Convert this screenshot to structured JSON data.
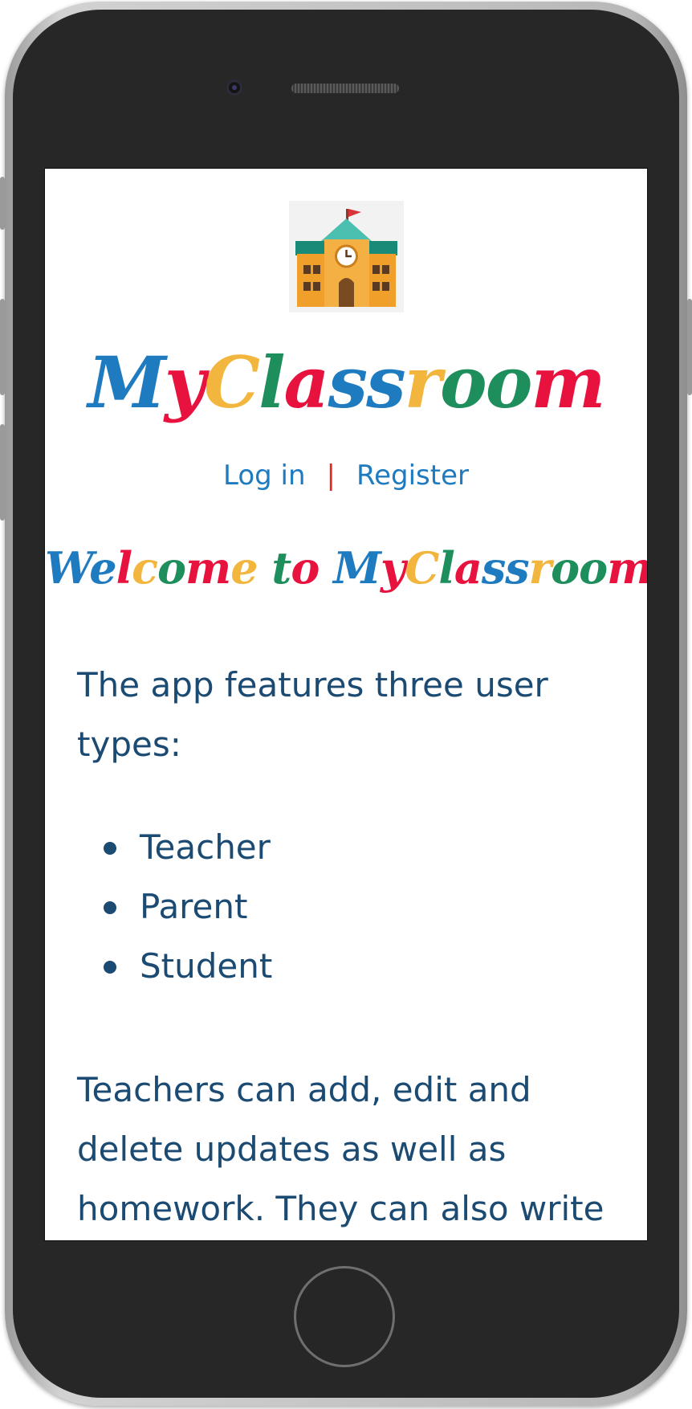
{
  "app": {
    "brand_title": "MyClassroom",
    "brand_letters": [
      {
        "ch": "M",
        "color": "#1f7bbf"
      },
      {
        "ch": "y",
        "color": "#e8123f"
      },
      {
        "ch": "C",
        "color": "#f2b63e"
      },
      {
        "ch": "l",
        "color": "#1e8f5c"
      },
      {
        "ch": "a",
        "color": "#e8123f"
      },
      {
        "ch": "s",
        "color": "#1f7bbf"
      },
      {
        "ch": "s",
        "color": "#1f7bbf"
      },
      {
        "ch": "r",
        "color": "#f2b63e"
      },
      {
        "ch": "o",
        "color": "#1e8f5c"
      },
      {
        "ch": "o",
        "color": "#1e8f5c"
      },
      {
        "ch": "m",
        "color": "#e8123f"
      }
    ]
  },
  "nav": {
    "login_label": "Log in",
    "separator": "|",
    "register_label": "Register"
  },
  "welcome": {
    "text": "Welcome to MyClassroom",
    "letters": [
      {
        "ch": "W",
        "color": "#1f7bbf"
      },
      {
        "ch": "e",
        "color": "#1f7bbf"
      },
      {
        "ch": "l",
        "color": "#e8123f"
      },
      {
        "ch": "c",
        "color": "#f2b63e"
      },
      {
        "ch": "o",
        "color": "#1e8f5c"
      },
      {
        "ch": "m",
        "color": "#e8123f"
      },
      {
        "ch": "e",
        "color": "#f2b63e"
      },
      {
        "ch": " ",
        "color": "#000000"
      },
      {
        "ch": "t",
        "color": "#1e8f5c"
      },
      {
        "ch": "o",
        "color": "#e8123f"
      },
      {
        "ch": " ",
        "color": "#000000"
      },
      {
        "ch": "M",
        "color": "#1f7bbf"
      },
      {
        "ch": "y",
        "color": "#e8123f"
      },
      {
        "ch": "C",
        "color": "#f2b63e"
      },
      {
        "ch": "l",
        "color": "#1e8f5c"
      },
      {
        "ch": "a",
        "color": "#e8123f"
      },
      {
        "ch": "s",
        "color": "#1f7bbf"
      },
      {
        "ch": "s",
        "color": "#1f7bbf"
      },
      {
        "ch": "r",
        "color": "#f2b63e"
      },
      {
        "ch": "o",
        "color": "#1e8f5c"
      },
      {
        "ch": "o",
        "color": "#1e8f5c"
      },
      {
        "ch": "m",
        "color": "#e8123f"
      }
    ]
  },
  "content": {
    "intro": "The app features three user types:",
    "user_types": [
      "Teacher",
      "Parent",
      "Student"
    ],
    "teachers_text": "Teachers can add, edit and delete updates as well as homework. They can also write comments"
  },
  "colors": {
    "body_text": "#1b4a72",
    "link": "#1f7bbf",
    "separator": "#e02a2a"
  },
  "icons": {
    "logo": "school-building-icon"
  }
}
